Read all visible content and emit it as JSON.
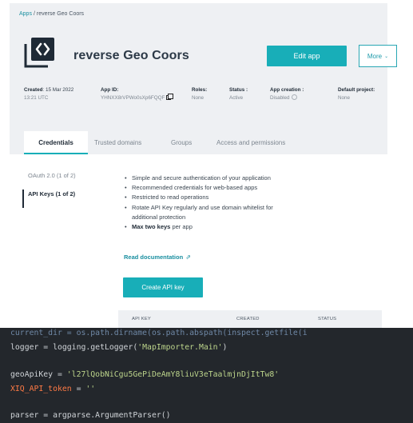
{
  "breadcrumb": {
    "root": "Apps",
    "separator": "/",
    "current": "reverse Geo Coors"
  },
  "app": {
    "name": "reverse Geo Coors",
    "logo_icon": "code-brackets-icon",
    "edit_label": "Edit app",
    "more_label": "More"
  },
  "meta": {
    "created_label": "Created",
    "created_date": ": 15 Mar 2022",
    "created_time": "13:21 UTC",
    "app_id_label": "App ID:",
    "app_id_value": "YHNXX8rVPWo0sXp6FQQF",
    "roles_label": "Roles:",
    "roles_value": "None",
    "status_label": "Status :",
    "status_value": "Active",
    "creation_label": "App creation :",
    "creation_value": "Disabled",
    "project_label": "Default project:",
    "project_value": "None"
  },
  "tabs": [
    "Credentials",
    "Trusted domains",
    "Groups",
    "Access and permissions"
  ],
  "side_nav": [
    "OAuth 2.0 (1 of 2)",
    "API Keys (1 of 2)"
  ],
  "features": [
    "Simple and secure authentication of your application",
    "Recommended credentials for web-based apps",
    "Restricted to read operations",
    "Rotate API Key regularly and use domain whitelist for",
    "additional protection"
  ],
  "feature_last": {
    "bold": "Max two keys",
    "rest": " per app"
  },
  "read_doc_label": "Read documentation",
  "create_label": "Create API key",
  "table_headers": [
    "API KEY",
    "CREATED",
    "STATUS"
  ],
  "code": {
    "line1": "current_dir = os.path.dirname(os.path.abspath(inspect.getfile(i",
    "line2_prefix": "logger = logging.getLogger(",
    "line2_string": "'MapImporter.Main'",
    "line2_suffix": ")",
    "line3_prefix": "geoApiKey = ",
    "line3_string": "'l27lQobNiCgu5GePiDeAmY8liuV3eTaalmjnDjItTw8'",
    "line4_name": "XIQ_API_token",
    "line4_eq": " = ",
    "line4_string": "''",
    "line5": "parser = argparse.ArgumentParser()"
  },
  "colors": {
    "accent": "#18aeb8",
    "editor_bg": "#23272c",
    "string": "#bcd48b",
    "highlight": "#ff7a45"
  }
}
